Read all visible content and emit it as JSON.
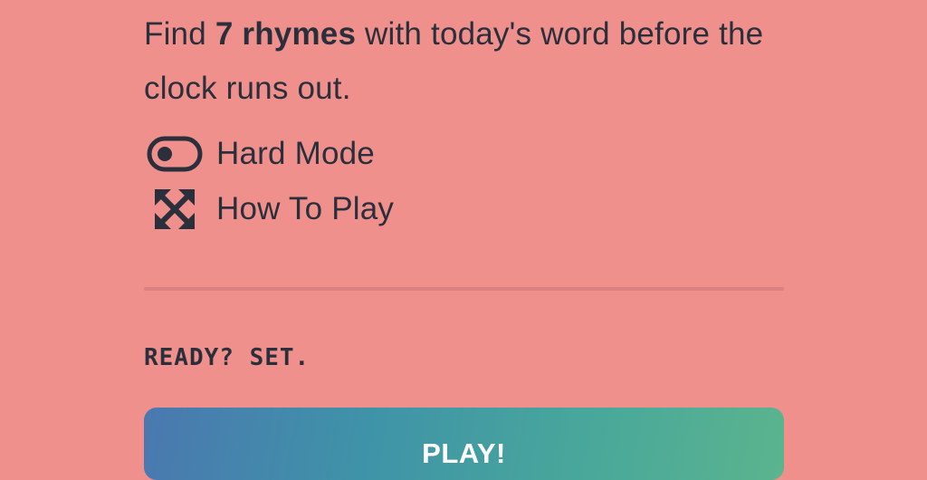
{
  "intro": {
    "text_before": "Find ",
    "highlight": "7 rhymes",
    "text_after": " with today's word before the clock runs out."
  },
  "options": {
    "hard_mode": {
      "label": "Hard Mode",
      "icon": "toggle-icon"
    },
    "how_to_play": {
      "label": "How To Play",
      "icon": "expand-arrows-icon"
    }
  },
  "ready_text": "READY? SET.",
  "play_button": {
    "label": "PLAY!"
  },
  "colors": {
    "background": "#ef908c",
    "text": "#2a2f3b",
    "play_gradient_start": "#4a78b0",
    "play_gradient_end": "#5bb48e"
  }
}
